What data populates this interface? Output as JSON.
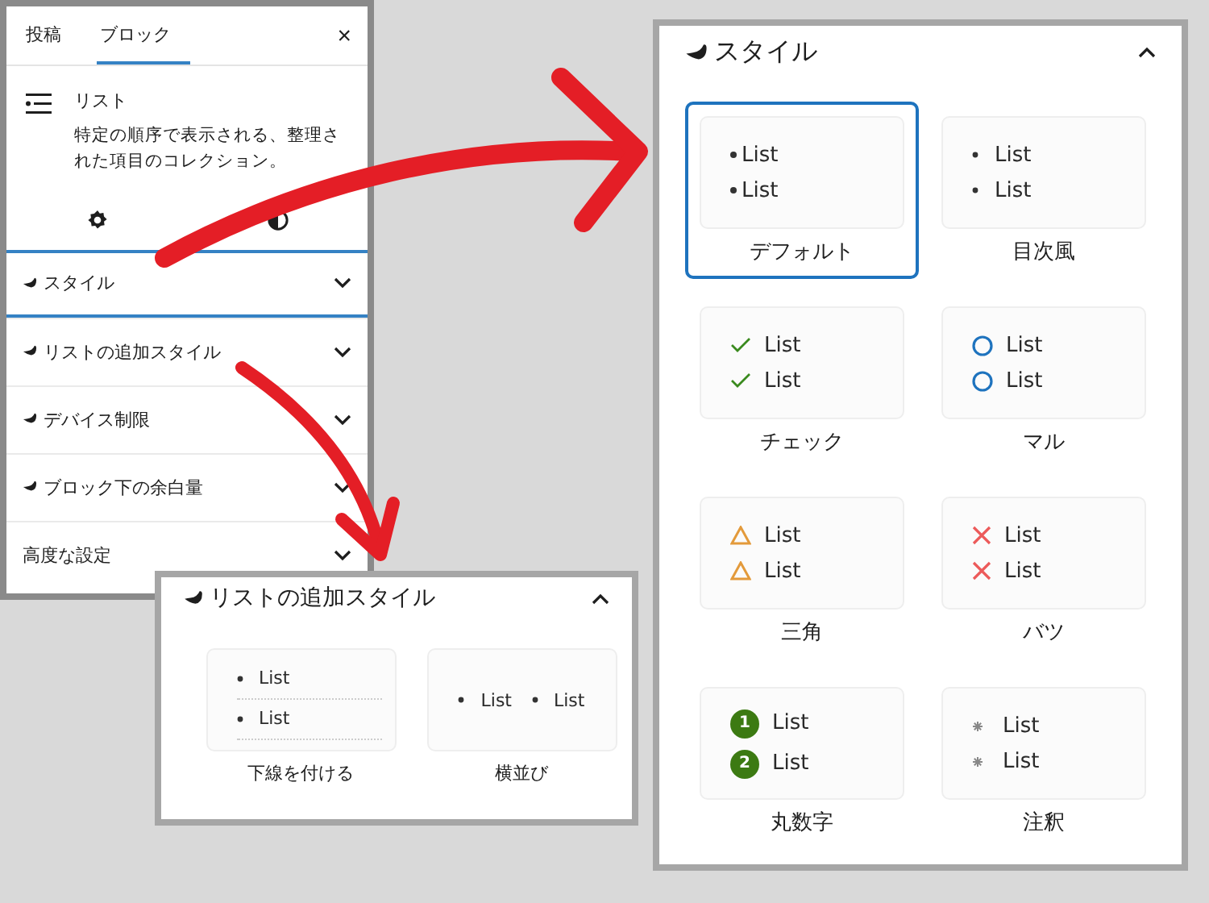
{
  "sidebar": {
    "tabs": [
      {
        "label": "投稿",
        "selected": false
      },
      {
        "label": "ブロック",
        "selected": true
      }
    ],
    "close": "×",
    "block": {
      "title": "リスト",
      "description": "特定の順序で表示される、整理された項目のコレクション。"
    },
    "sections": [
      {
        "label": "スタイル",
        "kind": "plugin",
        "focused": true
      },
      {
        "label": "リストの追加スタイル",
        "kind": "plugin",
        "focused": false
      },
      {
        "label": "デバイス制限",
        "kind": "plugin",
        "focused": false
      },
      {
        "label": "ブロック下の余白量",
        "kind": "plugin",
        "focused": false
      },
      {
        "label": "高度な設定",
        "kind": "core",
        "focused": false
      }
    ]
  },
  "extra_panel": {
    "title": "リストの追加スタイル",
    "options": [
      {
        "label": "下線を付ける",
        "kind": "underline",
        "selected": false,
        "items": [
          {
            "text": "List"
          },
          {
            "text": "List"
          }
        ]
      },
      {
        "label": "横並び",
        "kind": "inline",
        "selected": false,
        "items": [
          {
            "text": "List"
          },
          {
            "text": "List"
          }
        ]
      }
    ]
  },
  "style_panel": {
    "title": "スタイル",
    "options": [
      {
        "label": "デフォルト",
        "kind": "dot",
        "selected": true,
        "items": [
          {
            "text": "List"
          },
          {
            "text": "List"
          }
        ]
      },
      {
        "label": "目次風",
        "kind": "spaced",
        "selected": false,
        "items": [
          {
            "text": "List"
          },
          {
            "text": "List"
          }
        ]
      },
      {
        "label": "チェック",
        "kind": "check",
        "selected": false,
        "items": [
          {
            "text": "List"
          },
          {
            "text": "List"
          }
        ]
      },
      {
        "label": "マル",
        "kind": "circle",
        "selected": false,
        "items": [
          {
            "text": "List"
          },
          {
            "text": "List"
          }
        ]
      },
      {
        "label": "三角",
        "kind": "triangle",
        "selected": false,
        "items": [
          {
            "text": "List"
          },
          {
            "text": "List"
          }
        ]
      },
      {
        "label": "バツ",
        "kind": "cross",
        "selected": false,
        "items": [
          {
            "text": "List"
          },
          {
            "text": "List"
          }
        ]
      },
      {
        "label": "丸数字",
        "kind": "number",
        "selected": false,
        "items": [
          {
            "marker": "1",
            "text": "List"
          },
          {
            "marker": "2",
            "text": "List"
          }
        ]
      },
      {
        "label": "注釈",
        "kind": "asterisk",
        "selected": false,
        "items": [
          {
            "text": "List"
          },
          {
            "text": "List"
          }
        ]
      }
    ]
  }
}
